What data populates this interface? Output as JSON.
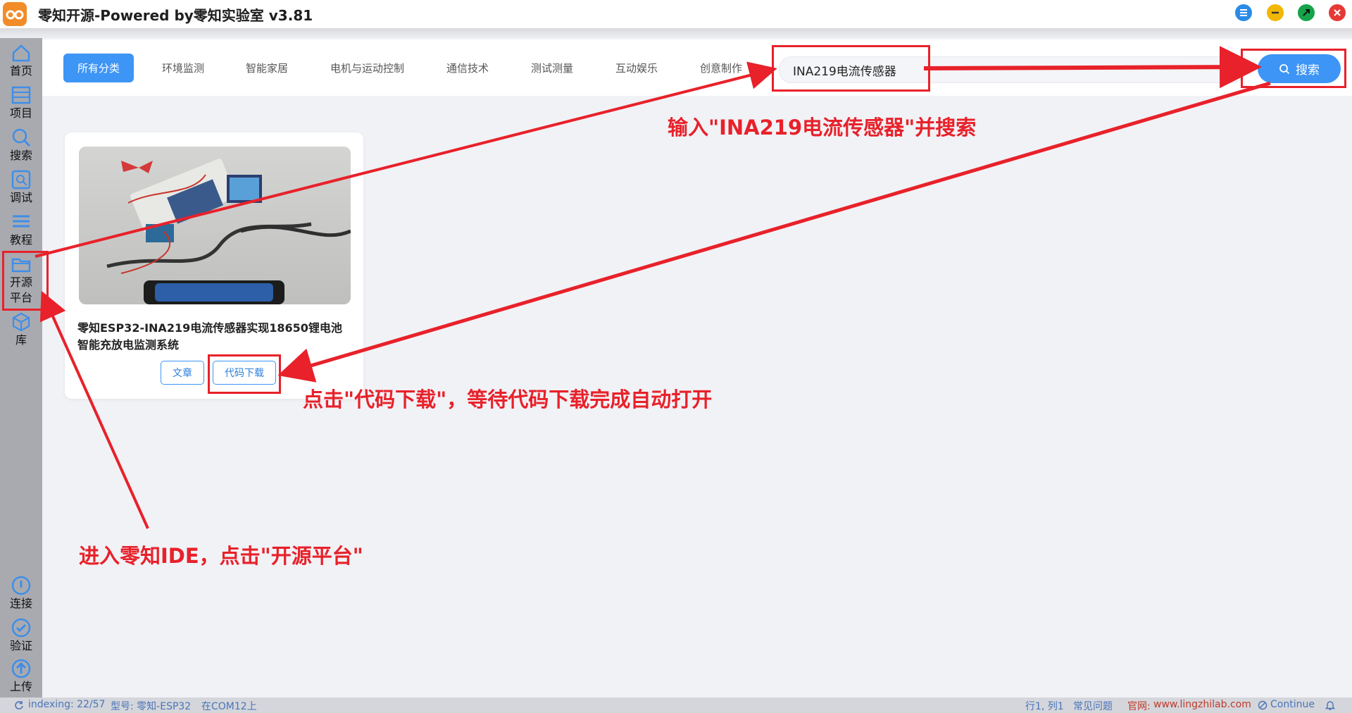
{
  "window": {
    "title": "零知开源-Powered by零知实验室 v3.81"
  },
  "sidebar": {
    "items": [
      {
        "label": "首页",
        "icon": "home-icon"
      },
      {
        "label": "项目",
        "icon": "project-icon"
      },
      {
        "label": "搜索",
        "icon": "search-icon"
      },
      {
        "label": "调试",
        "icon": "debug-icon"
      },
      {
        "label": "教程",
        "icon": "tutorial-icon"
      },
      {
        "label": "开源",
        "label2": "平台",
        "icon": "folder-icon"
      },
      {
        "label": "库",
        "icon": "library-icon"
      }
    ],
    "bottom": [
      {
        "label": "连接",
        "icon": "connect-icon"
      },
      {
        "label": "验证",
        "icon": "verify-icon"
      },
      {
        "label": "上传",
        "icon": "upload-icon"
      }
    ]
  },
  "categories": [
    "所有分类",
    "环境监测",
    "智能家居",
    "电机与运动控制",
    "通信技术",
    "测试测量",
    "互动娱乐",
    "创意制作"
  ],
  "search": {
    "value": "INA219电流传感器",
    "button": "搜索"
  },
  "card": {
    "title": "零知ESP32-INA219电流传感器实现18650锂电池智能充放电监测系统",
    "btn_article": "文章",
    "btn_download": "代码下载"
  },
  "statusbar": {
    "indexing": "indexing: 22/57",
    "model": "型号: 零知-ESP32",
    "port": "在COM12上",
    "position": "行1, 列1",
    "faq": "常见问题",
    "website_label": "官网:",
    "website": "www.lingzhilab.com",
    "continue": "Continue"
  },
  "annotations": {
    "search_hint": "输入\"INA219电流传感器\"并搜索",
    "download_hint": "点击\"代码下载\"，等待代码下载完成自动打开",
    "platform_hint": "进入零知IDE，点击\"开源平台\""
  },
  "colors": {
    "accent": "#3d95f5",
    "annotation": "#e8212a",
    "sidebar": "#a9aab0"
  }
}
